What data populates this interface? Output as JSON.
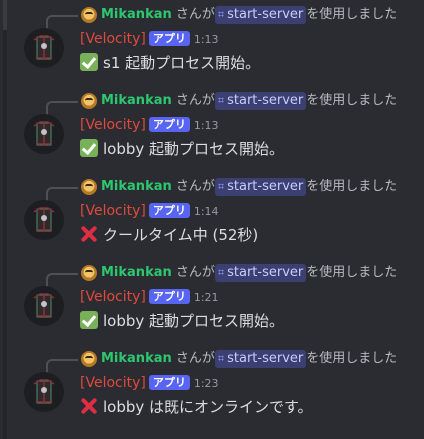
{
  "messages": [
    {
      "reply": {
        "user": "Mikankan",
        "particle": "さんが",
        "command": "start-server",
        "suffix": "を使用しました"
      },
      "author": "[Velocity]",
      "badge": "アプリ",
      "time": "1:13",
      "status_icon": "check-mark-icon",
      "text": "s1 起動プロセス開始。"
    },
    {
      "reply": {
        "user": "Mikankan",
        "particle": "さんが",
        "command": "start-server",
        "suffix": "を使用しました"
      },
      "author": "[Velocity]",
      "badge": "アプリ",
      "time": "1:13",
      "status_icon": "check-mark-icon",
      "text": "lobby 起動プロセス開始。"
    },
    {
      "reply": {
        "user": "Mikankan",
        "particle": "さんが",
        "command": "start-server",
        "suffix": "を使用しました"
      },
      "author": "[Velocity]",
      "badge": "アプリ",
      "time": "1:14",
      "status_icon": "cross-mark-icon",
      "text": "クールタイム中 (52秒)"
    },
    {
      "reply": {
        "user": "Mikankan",
        "particle": "さんが",
        "command": "start-server",
        "suffix": "を使用しました"
      },
      "author": "[Velocity]",
      "badge": "アプリ",
      "time": "1:21",
      "status_icon": "check-mark-icon",
      "text": "lobby 起動プロセス開始。"
    },
    {
      "reply": {
        "user": "Mikankan",
        "particle": "さんが",
        "command": "start-server",
        "suffix": "を使用しました"
      },
      "author": "[Velocity]",
      "badge": "アプリ",
      "time": "1:23",
      "status_icon": "cross-mark-icon",
      "text": "lobby は既にオンラインです。"
    }
  ],
  "colors": {
    "background": "#2b2c31",
    "author": "#e0493e",
    "reply_user": "#2dc770",
    "app_badge": "#5865f2",
    "command_chip": "#3b3f72",
    "success": "#78b159",
    "error": "#dd2e44"
  }
}
